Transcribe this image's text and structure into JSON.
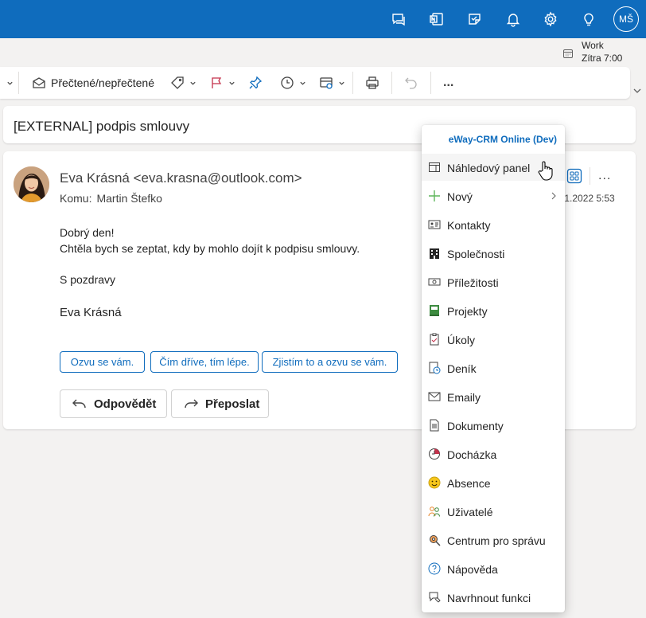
{
  "topbar": {
    "avatar_initials": "MŠ",
    "icons": [
      "chat-icon",
      "onenote-icon",
      "note-icon",
      "bell-icon",
      "gear-icon",
      "lightbulb-icon"
    ]
  },
  "reminder": {
    "title": "Work",
    "time": "Zítra 7:00"
  },
  "toolbar": {
    "read_unread_label": "Přečtené/nepřečtené",
    "more_label": "..."
  },
  "subject": "[EXTERNAL] podpis smlouvy",
  "message": {
    "from": "Eva Krásná <eva.krasna@outlook.com>",
    "to_label": "Komu:",
    "to_name": "Martin Štefko",
    "date": ".1.2022 5:53",
    "greeting": "Dobrý den!",
    "line": "Chtěla bych se zeptat, kdy by mohlo dojít k podpisu smlouvy.",
    "closing": "S pozdravy",
    "signature": "Eva Krásná",
    "suggestions": [
      "Ozvu se vám.",
      "Čím dříve, tím lépe.",
      "Zjistím to a ozvu se vám."
    ],
    "reply_label": "Odpovědět",
    "forward_label": "Přeposlat",
    "more_label": "..."
  },
  "dropdown": {
    "header": "eWay-CRM Online (Dev)",
    "items": [
      {
        "label": "Náhledový panel",
        "icon": "preview-panel-icon"
      },
      {
        "label": "Nový",
        "icon": "plus-icon"
      },
      {
        "label": "Kontakty",
        "icon": "contact-card-icon"
      },
      {
        "label": "Společnosti",
        "icon": "building-icon"
      },
      {
        "label": "Příležitosti",
        "icon": "money-icon"
      },
      {
        "label": "Projekty",
        "icon": "project-book-icon"
      },
      {
        "label": "Úkoly",
        "icon": "clipboard-icon"
      },
      {
        "label": "Deník",
        "icon": "journal-icon"
      },
      {
        "label": "Emaily",
        "icon": "envelope-icon"
      },
      {
        "label": "Dokumenty",
        "icon": "document-icon"
      },
      {
        "label": "Docházka",
        "icon": "attendance-clock-icon"
      },
      {
        "label": "Absence",
        "icon": "smiley-icon"
      },
      {
        "label": "Uživatelé",
        "icon": "users-icon"
      },
      {
        "label": "Centrum pro správu",
        "icon": "admin-gear-icon"
      },
      {
        "label": "Nápověda",
        "icon": "help-icon"
      },
      {
        "label": "Navrhnout funkci",
        "icon": "suggest-feature-icon"
      }
    ]
  },
  "colors": {
    "brand": "#0f6cbd",
    "hover": "#f5f5f5"
  }
}
